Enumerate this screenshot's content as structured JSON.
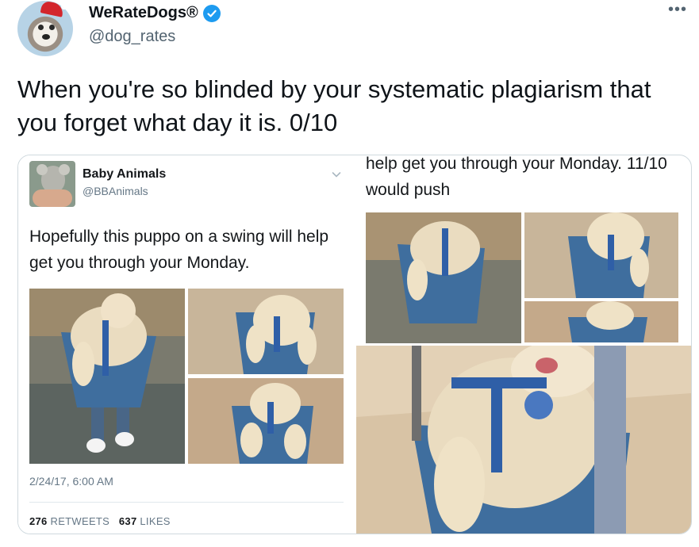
{
  "author": {
    "display_name": "WeRateDogs®",
    "handle": "@dog_rates",
    "verified": true,
    "more_icon": "more-horizontal-icon"
  },
  "tweet": {
    "text": "When you're so blinded by your systematic plagiarism that you forget what day it is. 0/10"
  },
  "quoted_image": {
    "left_screenshot": {
      "name": "Baby Animals",
      "handle": "@BBAnimals",
      "text": "Hopefully this puppo on a swing will help get you through your Monday.",
      "date": "2/24/17, 6:00 AM",
      "retweets_count": "276",
      "retweets_label": "RETWEETS",
      "likes_count": "637",
      "likes_label": "LIKES"
    },
    "right_screenshot": {
      "text": "help get you through your Monday. 11/10 would push"
    }
  },
  "colors": {
    "verified_blue": "#1d9bf0",
    "harness_blue": "#2f5fa7",
    "swing_blue": "#3f6e9e"
  }
}
